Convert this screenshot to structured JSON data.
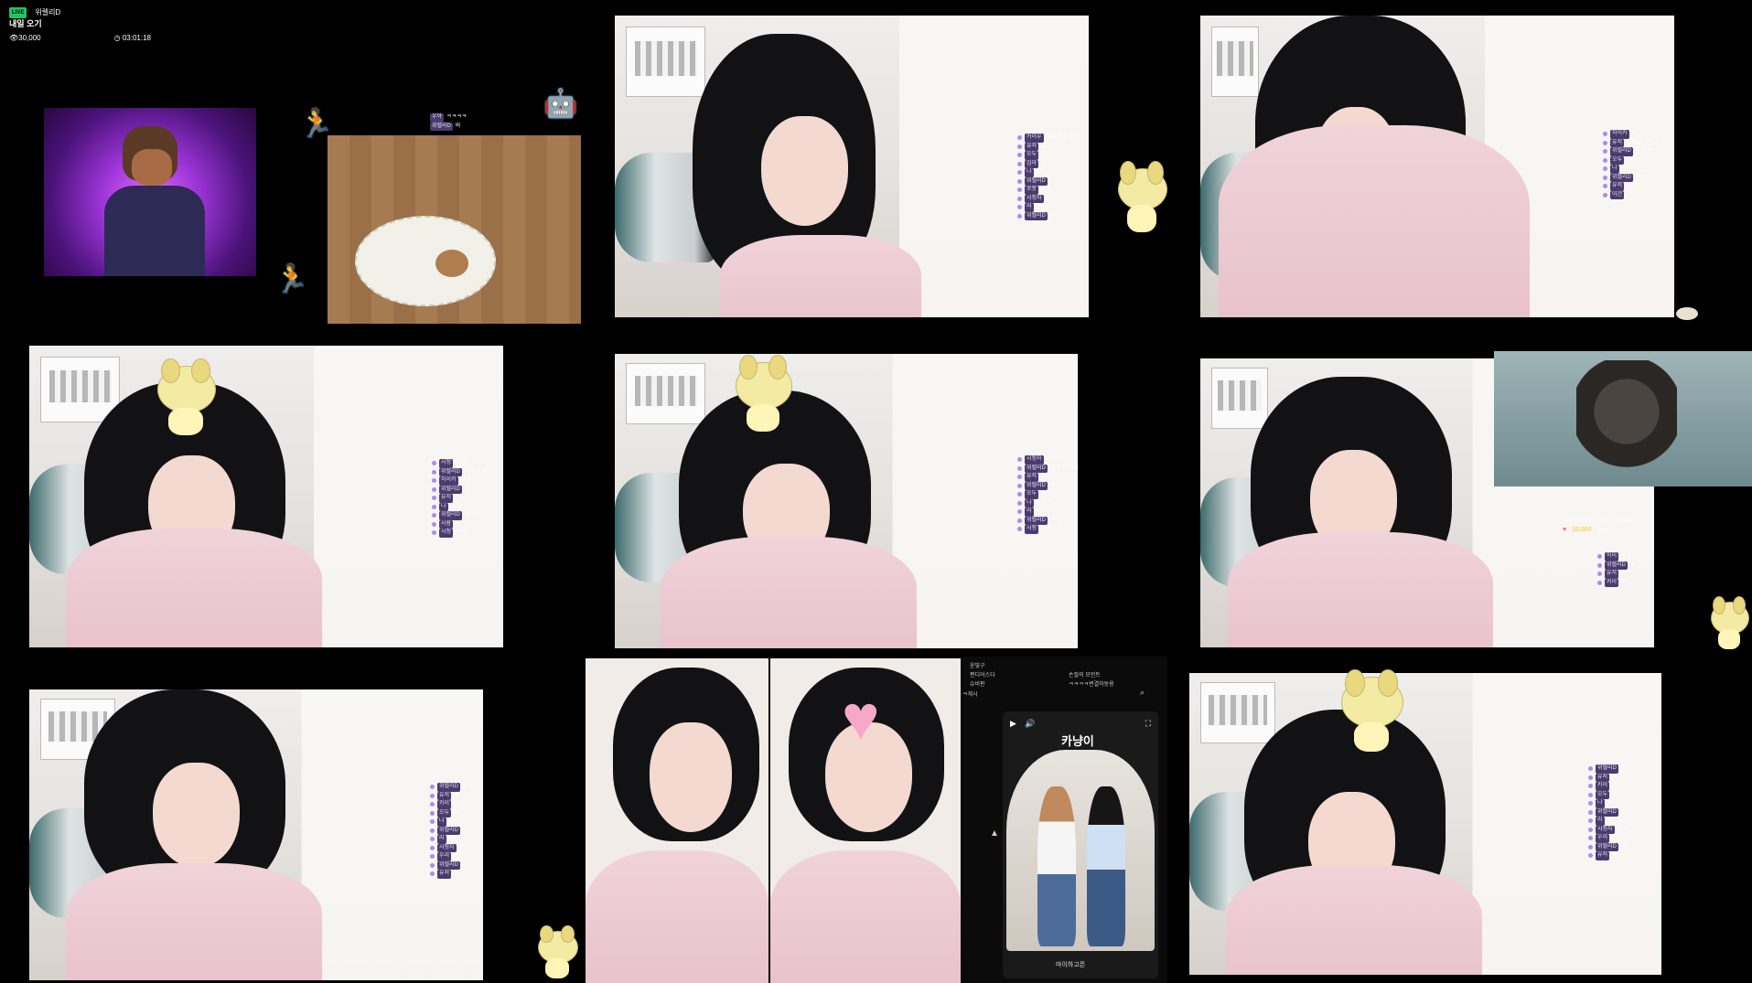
{
  "header": {
    "badge": "LIVE",
    "channel": "위렐리D",
    "title": "내일 오기",
    "viewers": "30,000",
    "uptime": "03:01:18"
  },
  "chat_panels": {
    "p1": [
      [
        "우야",
        "ㅋㅋㅋㅋ"
      ],
      [
        "위렐리D",
        "바"
      ]
    ],
    "p2": [
      [
        "카이우",
        "우선 미루세요"
      ],
      [
        "유저",
        "그"
      ],
      [
        "오두",
        "고"
      ],
      [
        "김아",
        "고"
      ],
      [
        "나",
        "2ㅋ"
      ],
      [
        "위렐리D",
        ""
      ],
      [
        "로봇",
        "ㅋㅋ"
      ],
      [
        "시청자",
        "ㅋㅋㅋㅋ"
      ],
      [
        "라",
        "ㅋㅋ"
      ],
      [
        "위렐리D",
        "ㅋ"
      ]
    ],
    "p3": [
      [
        "하이카",
        "우"
      ],
      [
        "유저",
        "그리고 이런 ㅅㅅ"
      ],
      [
        "위렐리D",
        "ㅋㅋㅋ"
      ],
      [
        "오두",
        "ㅋ"
      ],
      [
        "나",
        "ㅋ"
      ],
      [
        "위렐리D",
        "ㅋㅋ"
      ],
      [
        "유저",
        "ㅋㅋㅋ"
      ],
      [
        "이건",
        "ㅋ"
      ]
    ],
    "p4": [
      [
        "시청",
        "ㅋㅋ"
      ],
      [
        "위렐리D",
        "그리고 우리"
      ],
      [
        "하이카",
        "그래서"
      ],
      [
        "위렐리D",
        "요"
      ],
      [
        "유저",
        "ㅋㅋㅋㅋ"
      ],
      [
        "나",
        "그거"
      ],
      [
        "위렐리D",
        "ㅋㅋ"
      ],
      [
        "사람",
        "ㅋ"
      ],
      [
        "시청",
        "ㅋㅋ"
      ]
    ],
    "p5": [
      [
        "시청자",
        "ㅋㅋㅋㅋ"
      ],
      [
        "위렐리D",
        "그 인생 다시"
      ],
      [
        "유저",
        "ㅋㅋㅋ"
      ],
      [
        "위렐리D",
        "고"
      ],
      [
        "오두",
        "ㅋ"
      ],
      [
        "나",
        "ㅋㅋㅋ"
      ],
      [
        "라",
        "ㅋ"
      ],
      [
        "위렐리D",
        "ㅋ"
      ],
      [
        "시청",
        "ㅋㅋㅋㅋ"
      ]
    ],
    "p6": [
      [
        "위렐리D",
        "ㅋㅋ"
      ],
      [
        "유저",
        "우"
      ],
      [
        "카이",
        "ㅋ"
      ],
      [
        "오두",
        "다"
      ],
      [
        "나",
        "그"
      ],
      [
        "위렐리D",
        ""
      ],
      [
        "라",
        "ㅋ"
      ],
      [
        "시청자",
        "ㅋ"
      ],
      [
        "우리",
        "ㅋㅋ"
      ],
      [
        "위렐리D",
        "ㅋ"
      ],
      [
        "유저",
        ""
      ]
    ],
    "p7": [
      [
        "위렐리D",
        "ㅋ"
      ],
      [
        "유저",
        "ㅋ"
      ],
      [
        "카이",
        "이"
      ],
      [
        "오두",
        "우"
      ],
      [
        "나",
        "ㅋ"
      ],
      [
        "위렐리D",
        "ㅋ"
      ],
      [
        "라",
        "ㅋ"
      ],
      [
        "시청자",
        "ㅋㅋ"
      ],
      [
        "우리",
        "ㅋ"
      ],
      [
        "위렐리D",
        "ㅋ"
      ],
      [
        "유저",
        "ㅋ"
      ]
    ],
    "p8": [
      [
        "하이",
        "ㅋㅋ"
      ],
      [
        "위렐리D",
        "우"
      ],
      [
        "유저",
        "ㅋ"
      ],
      [
        "카이",
        "ㅋ"
      ]
    ]
  },
  "donation": {
    "message": "이번 라운드 사람 ... 테스트",
    "amount": "10,000",
    "unit": "후원"
  },
  "yt_panel": {
    "title": "카냥이",
    "footer": "마이하고픈",
    "header_rows": [
      "윤빛구",
      "편디어스다",
      "슈비판"
    ],
    "header_right": [
      "손절의 모먼트",
      "ㅋㅋㅋㅋ변결하동용"
    ],
    "side_label": "ㅋ게시"
  },
  "colors": {
    "live": "#18c864",
    "chat_nick": "#4a3b6b",
    "donation_amount": "#ffd34d",
    "heart": "#f6a8c8"
  }
}
